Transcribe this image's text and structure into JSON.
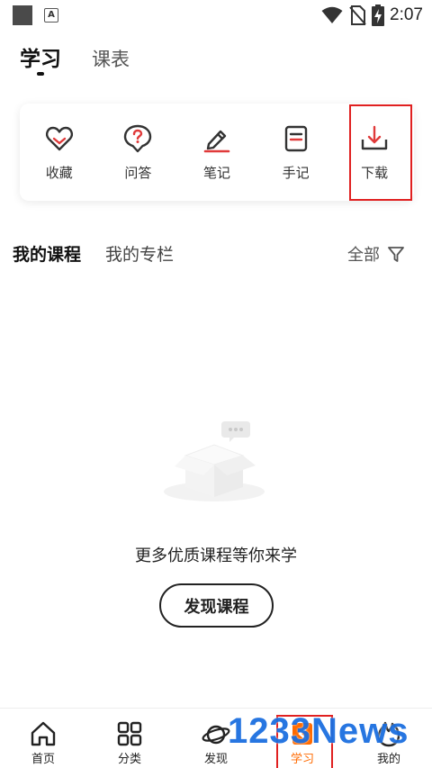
{
  "status_bar": {
    "time": "2:07"
  },
  "top_tabs": [
    {
      "label": "学习",
      "active": true
    },
    {
      "label": "课表",
      "active": false
    }
  ],
  "tools": [
    {
      "label": "收藏",
      "icon": "heart-icon"
    },
    {
      "label": "问答",
      "icon": "question-bubble-icon"
    },
    {
      "label": "笔记",
      "icon": "pen-icon"
    },
    {
      "label": "手记",
      "icon": "note-icon"
    },
    {
      "label": "下载",
      "icon": "download-icon"
    }
  ],
  "course_tabs": [
    {
      "label": "我的课程",
      "active": true
    },
    {
      "label": "我的专栏",
      "active": false
    }
  ],
  "filter": {
    "label": "全部",
    "icon": "filter-icon"
  },
  "empty_state": {
    "message": "更多优质课程等你来学",
    "button_label": "发现课程"
  },
  "bottom_nav": [
    {
      "label": "首页",
      "icon": "home-icon"
    },
    {
      "label": "分类",
      "icon": "grid-icon"
    },
    {
      "label": "发现",
      "icon": "planet-icon"
    },
    {
      "label": "学习",
      "icon": "study-icon",
      "active": true
    },
    {
      "label": "我的",
      "icon": "profile-icon"
    }
  ],
  "watermark": "1233News",
  "colors": {
    "accent": "#ff6a00",
    "highlight_box": "#e02020",
    "icon_red": "#e03a3a",
    "watermark": "#1c6fe0"
  }
}
